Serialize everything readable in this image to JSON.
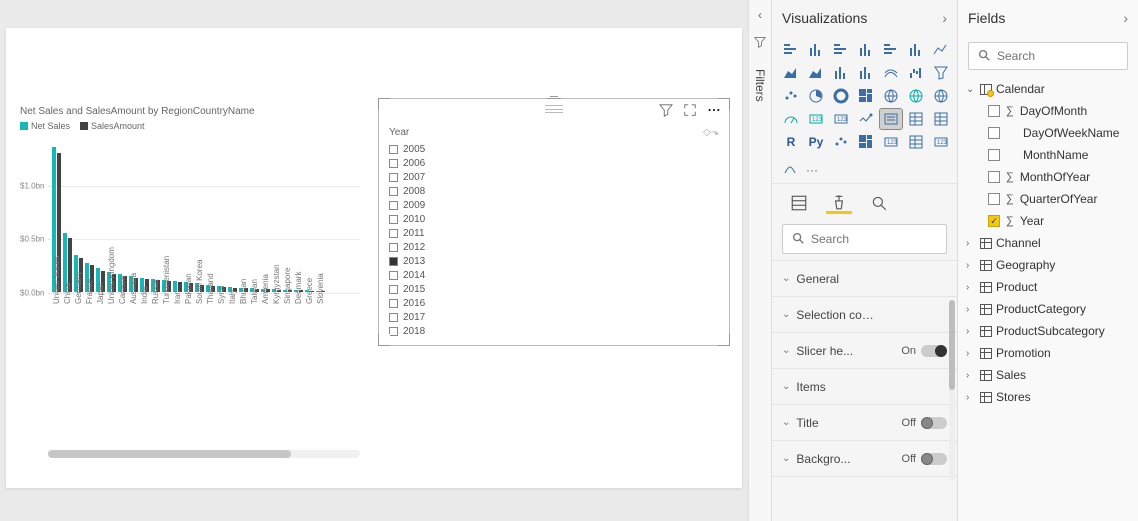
{
  "filtersRail": {
    "label": "Filters"
  },
  "vizPane": {
    "title": "Visualizations",
    "searchPlaceholder": "Search",
    "gallery": [
      "stacked-bar",
      "stacked-column",
      "clustered-bar",
      "clustered-column",
      "100-stacked-bar",
      "100-stacked-column",
      "line",
      "area",
      "stacked-area",
      "line-stacked-column",
      "line-clustered-column",
      "ribbon",
      "waterfall",
      "funnel",
      "scatter",
      "pie",
      "donut",
      "treemap",
      "map",
      "filled-map",
      "shape-map",
      "gauge",
      "card",
      "multi-row-card",
      "kpi",
      "slicer",
      "table",
      "matrix",
      "r-visual",
      "py-visual",
      "key-influencers",
      "decomposition-tree",
      "qa",
      "paginated",
      "powerapps",
      "arcgis",
      "more"
    ],
    "format": [
      {
        "label": "General",
        "toggle": null
      },
      {
        "label": "Selection controls",
        "toggle": null
      },
      {
        "label": "Slicer he...",
        "toggle": "On"
      },
      {
        "label": "Items",
        "toggle": null
      },
      {
        "label": "Title",
        "toggle": "Off"
      },
      {
        "label": "Backgro...",
        "toggle": "Off"
      }
    ]
  },
  "fieldsPane": {
    "title": "Fields",
    "searchPlaceholder": "Search",
    "tables": [
      {
        "name": "Calendar",
        "expanded": true,
        "badge": true,
        "fields": [
          {
            "name": "DayOfMonth",
            "sigma": true,
            "checked": false
          },
          {
            "name": "DayOfWeekName",
            "sigma": false,
            "checked": false
          },
          {
            "name": "MonthName",
            "sigma": false,
            "checked": false
          },
          {
            "name": "MonthOfYear",
            "sigma": true,
            "checked": false
          },
          {
            "name": "QuarterOfYear",
            "sigma": true,
            "checked": false
          },
          {
            "name": "Year",
            "sigma": true,
            "checked": true
          }
        ]
      },
      {
        "name": "Channel",
        "expanded": false
      },
      {
        "name": "Geography",
        "expanded": false
      },
      {
        "name": "Product",
        "expanded": false
      },
      {
        "name": "ProductCategory",
        "expanded": false
      },
      {
        "name": "ProductSubcategory",
        "expanded": false
      },
      {
        "name": "Promotion",
        "expanded": false
      },
      {
        "name": "Sales",
        "expanded": false
      },
      {
        "name": "Stores",
        "expanded": false
      }
    ]
  },
  "slicer": {
    "header": "Year",
    "items": [
      {
        "label": "2005",
        "checked": false
      },
      {
        "label": "2006",
        "checked": false
      },
      {
        "label": "2007",
        "checked": false
      },
      {
        "label": "2008",
        "checked": false
      },
      {
        "label": "2009",
        "checked": false
      },
      {
        "label": "2010",
        "checked": false
      },
      {
        "label": "2011",
        "checked": false
      },
      {
        "label": "2012",
        "checked": false
      },
      {
        "label": "2013",
        "checked": true
      },
      {
        "label": "2014",
        "checked": false
      },
      {
        "label": "2015",
        "checked": false
      },
      {
        "label": "2016",
        "checked": false
      },
      {
        "label": "2017",
        "checked": false
      },
      {
        "label": "2018",
        "checked": false
      }
    ]
  },
  "chart_data": {
    "type": "bar",
    "title": "Net Sales and SalesAmount by RegionCountryName",
    "ylabel": "",
    "yticks": [
      "$0.0bn",
      "$0.5bn",
      "$1.0bn"
    ],
    "ylim": [
      0,
      1.4
    ],
    "legend": [
      {
        "name": "Net Sales",
        "color": "#14b8b8"
      },
      {
        "name": "SalesAmount",
        "color": "#444444"
      }
    ],
    "categories": [
      "United States",
      "China",
      "Germany",
      "France",
      "Japan",
      "United Kingdom",
      "Canada",
      "Australia",
      "India",
      "Russia",
      "Turkmenistan",
      "Iran",
      "Pakistan",
      "South Korea",
      "Thailand",
      "Syria",
      "Italy",
      "Bhutan",
      "Taiwan",
      "Armenia",
      "Kyrgyzstan",
      "Singapore",
      "Denmark",
      "Greece",
      "Slovenia"
    ],
    "series": [
      {
        "name": "Net Sales",
        "values": [
          1.35,
          0.55,
          0.35,
          0.27,
          0.22,
          0.19,
          0.17,
          0.15,
          0.13,
          0.12,
          0.11,
          0.1,
          0.09,
          0.08,
          0.07,
          0.06,
          0.05,
          0.04,
          0.04,
          0.03,
          0.03,
          0.02,
          0.02,
          0.02,
          0.01
        ]
      },
      {
        "name": "SalesAmount",
        "values": [
          1.3,
          0.5,
          0.32,
          0.25,
          0.2,
          0.17,
          0.15,
          0.13,
          0.12,
          0.11,
          0.1,
          0.09,
          0.08,
          0.07,
          0.06,
          0.05,
          0.04,
          0.04,
          0.03,
          0.03,
          0.02,
          0.02,
          0.02,
          0.01,
          0.01
        ]
      }
    ]
  }
}
